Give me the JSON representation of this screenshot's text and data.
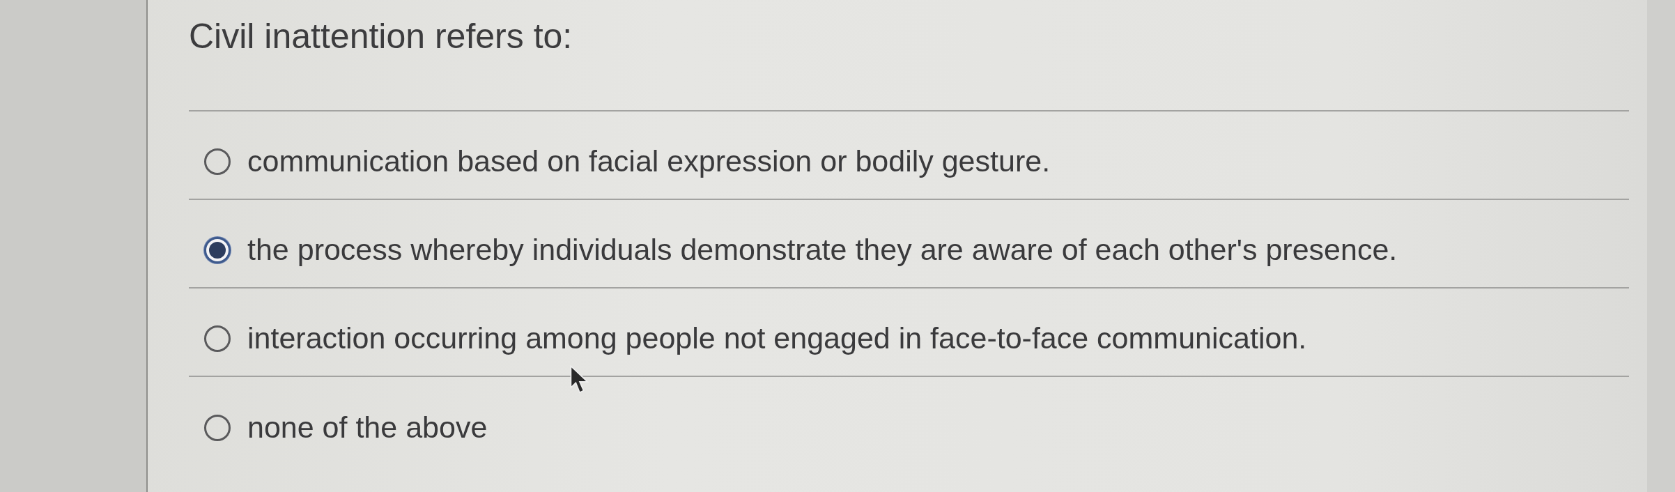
{
  "question": {
    "text": "Civil inattention refers to:"
  },
  "options": [
    {
      "label": "communication based on facial expression or bodily gesture.",
      "selected": false
    },
    {
      "label": "the process whereby individuals demonstrate they are aware of each other's presence.",
      "selected": true
    },
    {
      "label": "interaction occurring among people not engaged in face-to-face communication.",
      "selected": false
    },
    {
      "label": "none of the above",
      "selected": false
    }
  ]
}
